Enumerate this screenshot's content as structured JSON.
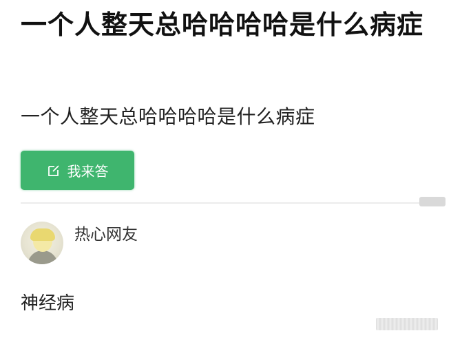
{
  "question": {
    "title": "一个人整天总哈哈哈哈是什么病症",
    "body": "一个人整天总哈哈哈哈是什么病症"
  },
  "answer_button": {
    "label": "我来答",
    "icon": "edit-icon",
    "color": "#3fb56e"
  },
  "answer": {
    "username": "热心网友",
    "avatar": "avatar-image",
    "text": "神经病"
  }
}
